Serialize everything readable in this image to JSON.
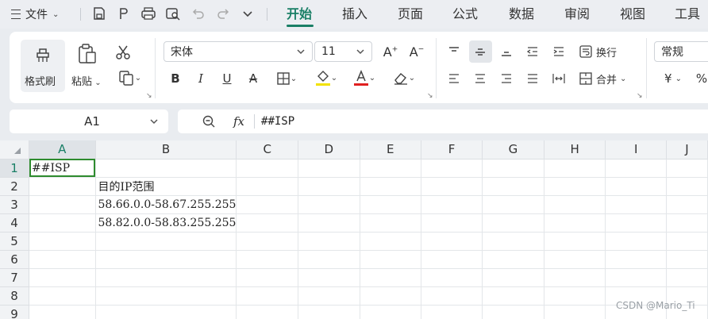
{
  "menubar": {
    "file_label": "文件",
    "tabs": [
      "开始",
      "插入",
      "页面",
      "公式",
      "数据",
      "审阅",
      "视图",
      "工具"
    ],
    "active_tab": "开始"
  },
  "ribbon": {
    "format_painter_label": "格式刷",
    "paste_label": "粘贴",
    "font_name": "宋体",
    "font_size": "11",
    "wrap_label": "换行",
    "merge_label": "合并",
    "number_format": "常规",
    "currency_symbol": "¥",
    "percent_symbol": "%"
  },
  "formula_bar": {
    "name_box": "A1",
    "fx_label": "fx",
    "formula": "##ISP"
  },
  "sheet": {
    "columns": [
      "A",
      "B",
      "C",
      "D",
      "E",
      "F",
      "G",
      "H",
      "I",
      "J"
    ],
    "rows": [
      "1",
      "2",
      "3",
      "4",
      "5",
      "6",
      "7",
      "8",
      "9"
    ],
    "cells": {
      "A1": "##ISP",
      "B2": "目的IP范围",
      "B3": "58.66.0.0-58.67.255.255",
      "B4": "58.82.0.0-58.83.255.255"
    },
    "selected_column": "A",
    "selected_row": "1"
  },
  "watermark": "CSDN @Mario_Ti",
  "colors": {
    "accent": "#1a7f66",
    "active_cell_border": "#2e8b2e",
    "highlight_bar": "#f2e200",
    "font_color_bar": "#e02020"
  }
}
